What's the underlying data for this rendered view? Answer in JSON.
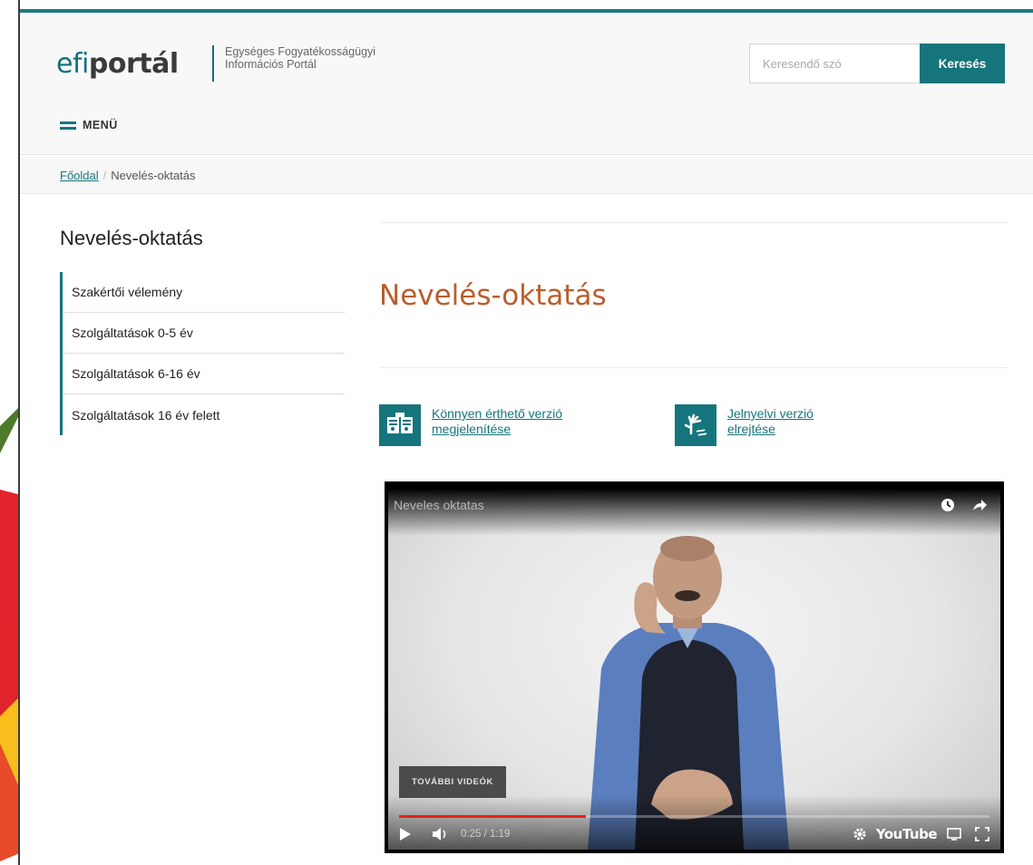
{
  "header": {
    "logo_efi": "efi",
    "logo_portal": "portál",
    "tagline_line1": "Egységes Fogyatékosságügyi",
    "tagline_line2": "Információs Portál",
    "menu_label": "MENÜ"
  },
  "search": {
    "placeholder": "Keresendő szó",
    "value": "",
    "button_label": "Keresés"
  },
  "breadcrumb": {
    "home": "Főoldal",
    "separator": "/",
    "current": "Nevelés-oktatás"
  },
  "sidebar": {
    "title": "Nevelés-oktatás",
    "items": [
      {
        "label": "Szakértői vélemény"
      },
      {
        "label": "Szolgáltatások 0-5 év"
      },
      {
        "label": "Szolgáltatások 6-16 év"
      },
      {
        "label": "Szolgáltatások 16 év felett"
      }
    ]
  },
  "main": {
    "title": "Nevelés-oktatás",
    "easy_read_link": "Könnyen érthető verzió megjelenítése",
    "easy_read_icon": "easy-read-book-icon",
    "sign_language_link": "Jelnyelvi verzió elrejtése",
    "sign_language_icon": "sign-language-hand-icon"
  },
  "video": {
    "title": "Neveles oktatas",
    "more_videos": "TOVÁBBI VIDEÓK",
    "current_time": "0:25",
    "duration": "1:19",
    "time_display": "0:25 / 1:19",
    "progress_percent": 31.6,
    "brand": "YouTube"
  },
  "colors": {
    "brand_teal": "#16757c",
    "title_orange": "#b85e2d",
    "progress_red": "#e62117"
  }
}
